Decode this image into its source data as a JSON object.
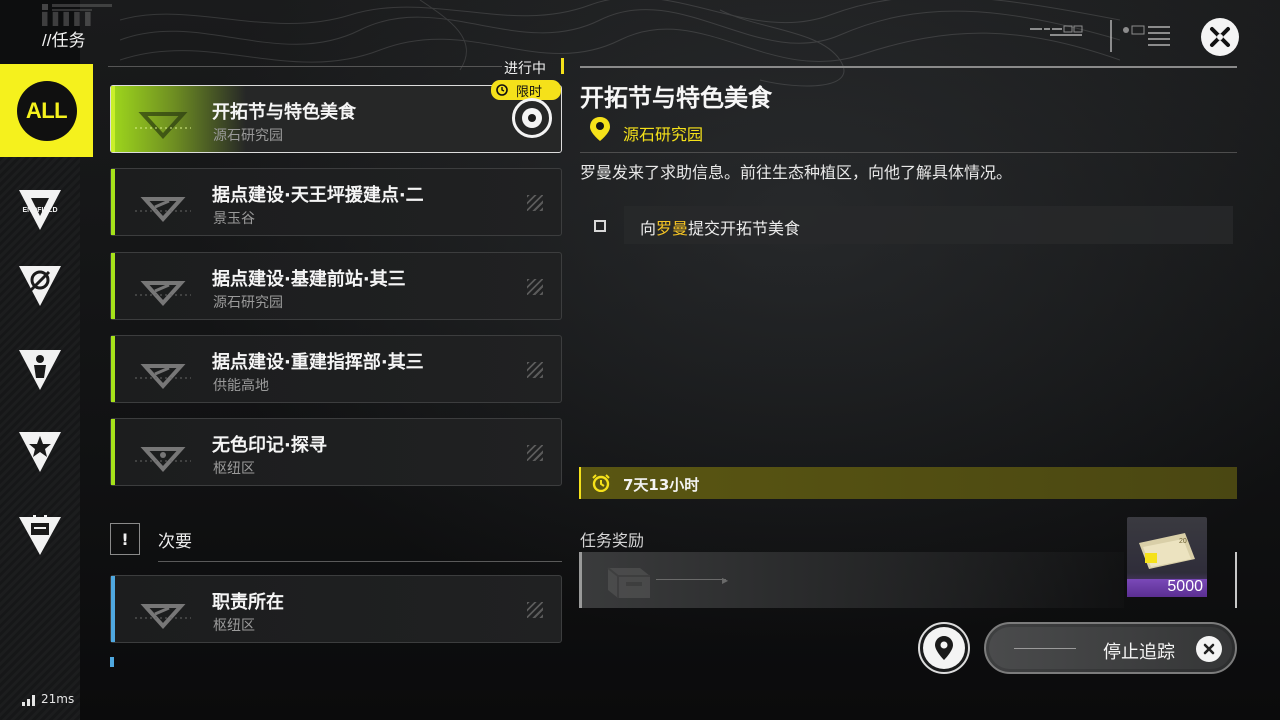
{
  "header": {
    "title": "//任务",
    "close_icon": "close-x-icon"
  },
  "rail": {
    "items": [
      {
        "label": "ALL",
        "icon": "all-badge",
        "active": true
      },
      {
        "label": "ENDFIELD",
        "icon": "endfield-triangle-icon"
      },
      {
        "label": "",
        "icon": "daily-triangle-icon"
      },
      {
        "label": "",
        "icon": "character-triangle-icon"
      },
      {
        "label": "",
        "icon": "star-triangle-icon"
      },
      {
        "label": "",
        "icon": "event-triangle-icon"
      }
    ]
  },
  "quest_list": {
    "in_progress_label": "进行中",
    "limited_label": "限时",
    "quests": [
      {
        "name": "开拓节与特色美食",
        "location": "源石研究园",
        "active": true
      },
      {
        "name": "据点建设·天王坪援建点·二",
        "location": "景玉谷"
      },
      {
        "name": "据点建设·基建前站·其三",
        "location": "源石研究园"
      },
      {
        "name": "据点建设·重建指挥部·其三",
        "location": "供能高地"
      },
      {
        "name": "无色印记·探寻",
        "location": "枢纽区"
      }
    ],
    "secondary": {
      "badge": "!",
      "label": "次要",
      "quests": [
        {
          "name": "职责所在",
          "location": "枢纽区"
        }
      ]
    }
  },
  "detail": {
    "title": "开拓节与特色美食",
    "location": "源石研究园",
    "description": "罗曼发来了求助信息。前往生态种植区，向他了解具体情况。",
    "objective": {
      "prefix": "向",
      "highlight": "罗曼",
      "suffix": "提交开拓节美食"
    },
    "time_remaining": "7天13小时",
    "reward_label": "任务奖励",
    "reward_item": {
      "count": "5000",
      "rarity_color": "#6b3d9e"
    },
    "stop_tracking_label": "停止追踪"
  },
  "status": {
    "ping": "21ms"
  },
  "colors": {
    "accent_yellow": "#f5e11a",
    "active_green": "#a6e21a",
    "secondary_blue": "#4fa8e0"
  }
}
